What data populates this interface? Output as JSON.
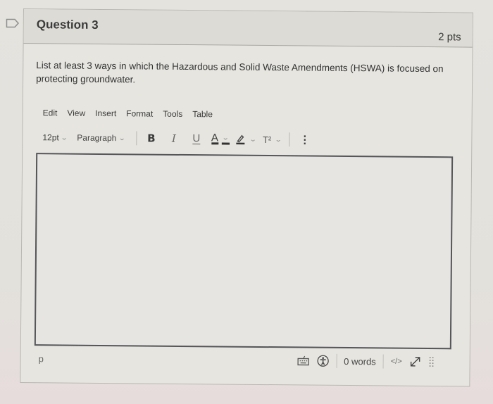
{
  "question": {
    "title": "Question 3",
    "points": "2 pts",
    "prompt": "List at least 3 ways in which the Hazardous and Solid Waste Amendments (HSWA) is focused on protecting groundwater."
  },
  "editor": {
    "menu": [
      "Edit",
      "View",
      "Insert",
      "Format",
      "Tools",
      "Table"
    ],
    "toolbar": {
      "font_size": "12pt",
      "block_format": "Paragraph",
      "bold": "B",
      "italic": "I",
      "underline": "U",
      "font_color": "A",
      "superscript": "T²",
      "more": "⋮"
    },
    "content": "",
    "status": {
      "path": "p",
      "word_count": "0 words",
      "html_toggle": "</>"
    }
  },
  "icons": {
    "flag": "flag-icon",
    "keyboard": "keyboard-icon",
    "accessibility": "accessibility-icon",
    "fullscreen": "fullscreen-icon",
    "resize": "resize-handle-icon",
    "highlight": "highlighter-icon"
  },
  "colors": {
    "background": "#e3e1dc",
    "header": "#dcdbd5",
    "editor_border": "#55555a",
    "text": "#3a3a3a"
  }
}
